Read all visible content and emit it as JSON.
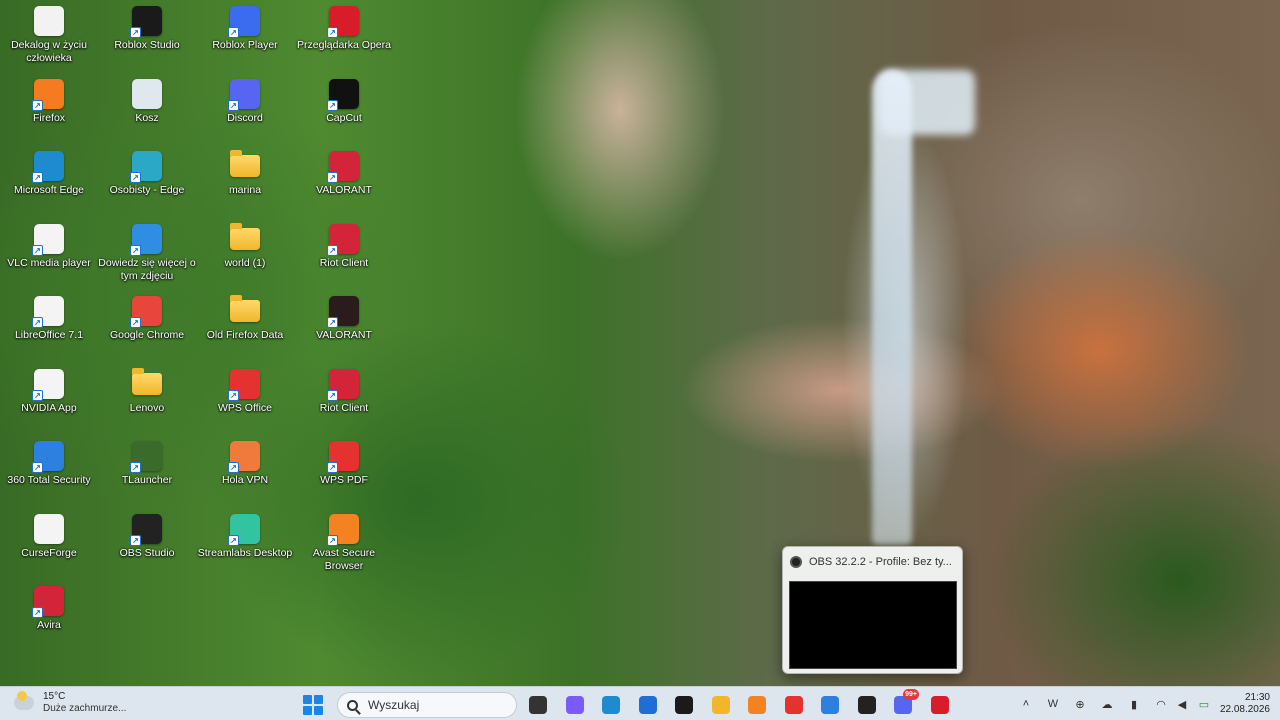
{
  "desktop": {
    "icons": [
      {
        "label": "Dekalog w życiu człowieka",
        "icon": "document-icon",
        "color": "#f2f2f2"
      },
      {
        "label": "Roblox Studio",
        "icon": "roblox-studio-icon",
        "color": "#1a1a1a"
      },
      {
        "label": "Roblox Player",
        "icon": "roblox-player-icon",
        "color": "#3b6cf0"
      },
      {
        "label": "Przeglądarka Opera",
        "icon": "opera-icon",
        "color": "#d81c2a"
      },
      {
        "label": "Firefox",
        "icon": "firefox-icon",
        "color": "#f57a20"
      },
      {
        "label": "Kosz",
        "icon": "recycle-bin-icon",
        "color": "#dfe7ef"
      },
      {
        "label": "Discord",
        "icon": "discord-icon",
        "color": "#5865f2"
      },
      {
        "label": "CapCut",
        "icon": "capcut-icon",
        "color": "#111111"
      },
      {
        "label": "Microsoft Edge",
        "icon": "edge-icon",
        "color": "#1e8bd1"
      },
      {
        "label": "Osobisty - Edge",
        "icon": "edge-profile-icon",
        "color": "#2aa8c5"
      },
      {
        "label": "marina",
        "icon": "folder-icon",
        "color": "#f0b62c"
      },
      {
        "label": "VALORANT",
        "icon": "valorant-riot-icon",
        "color": "#d3243a"
      },
      {
        "label": "VLC media player",
        "icon": "vlc-icon",
        "color": "#f4f4f4"
      },
      {
        "label": "Dowiedz się więcej o tym zdjęciu",
        "icon": "spotlight-icon",
        "color": "#2f8de4"
      },
      {
        "label": "world (1)",
        "icon": "folder-icon",
        "color": "#f0b62c"
      },
      {
        "label": "Riot Client",
        "icon": "riot-client-icon",
        "color": "#d3243a"
      },
      {
        "label": "LibreOffice 7.1",
        "icon": "libreoffice-icon",
        "color": "#f4f4f4"
      },
      {
        "label": "Google Chrome",
        "icon": "chrome-icon",
        "color": "#e8453c"
      },
      {
        "label": "Old Firefox Data",
        "icon": "folder-icon",
        "color": "#f0b62c"
      },
      {
        "label": "VALORANT",
        "icon": "valorant-icon",
        "color": "#2a1c1c"
      },
      {
        "label": "NVIDIA App",
        "icon": "nvidia-icon",
        "color": "#f4f4f4"
      },
      {
        "label": "Lenovo",
        "icon": "folder-icon",
        "color": "#f0b62c"
      },
      {
        "label": "WPS Office",
        "icon": "wps-office-icon",
        "color": "#e5312f"
      },
      {
        "label": "Riot Client",
        "icon": "riot-client-icon",
        "color": "#d3243a"
      },
      {
        "label": "360 Total Security",
        "icon": "shield-plus-icon",
        "color": "#2d7fe0"
      },
      {
        "label": "TLauncher",
        "icon": "tlauncher-icon",
        "color": "#3a6b2a"
      },
      {
        "label": "Hola VPN",
        "icon": "hola-vpn-icon",
        "color": "#f07a3c"
      },
      {
        "label": "WPS PDF",
        "icon": "wps-pdf-icon",
        "color": "#e5312f"
      },
      {
        "label": "CurseForge",
        "icon": "document-icon",
        "color": "#f4f4f4"
      },
      {
        "label": "OBS Studio",
        "icon": "obs-icon",
        "color": "#222222"
      },
      {
        "label": "Streamlabs Desktop",
        "icon": "streamlabs-icon",
        "color": "#31c3a2"
      },
      {
        "label": "Avast Secure Browser",
        "icon": "avast-browser-icon",
        "color": "#f58220"
      },
      {
        "label": "Avira",
        "icon": "avira-icon",
        "color": "#d3243a"
      }
    ]
  },
  "obs_popup": {
    "title": "OBS 32.2.2 - Profile: Bez ty..."
  },
  "taskbar": {
    "weather": {
      "temp": "15°C",
      "desc": "Duże zachmurze..."
    },
    "search_placeholder": "Wyszukaj",
    "apps": [
      {
        "icon": "file-explorer-dark-icon",
        "color": "#333333"
      },
      {
        "icon": "copilot-icon",
        "color": "#7a5af8"
      },
      {
        "icon": "edge-icon",
        "color": "#1e8bd1"
      },
      {
        "icon": "microsoft-store-icon",
        "color": "#1e6ed6"
      },
      {
        "icon": "roblox-studio-icon",
        "color": "#1a1a1a"
      },
      {
        "icon": "file-explorer-icon",
        "color": "#f0b62c"
      },
      {
        "icon": "avast-browser-icon",
        "color": "#f58220"
      },
      {
        "icon": "wps-office-icon",
        "color": "#e5312f"
      },
      {
        "icon": "360-security-icon",
        "color": "#2d7fe0"
      },
      {
        "icon": "obs-icon",
        "color": "#222222"
      },
      {
        "icon": "discord-icon",
        "color": "#5865f2",
        "badge": "99+"
      },
      {
        "icon": "opera-icon",
        "color": "#d81c2a"
      }
    ],
    "tray": [
      "chevron-up-icon",
      "wps-tray-icon",
      "360-tray-icon",
      "onedrive-icon",
      "microphone-icon",
      "wifi-icon",
      "volume-icon",
      "battery-icon"
    ],
    "clock": {
      "time": "21:30",
      "date": "22.08.2026"
    }
  }
}
